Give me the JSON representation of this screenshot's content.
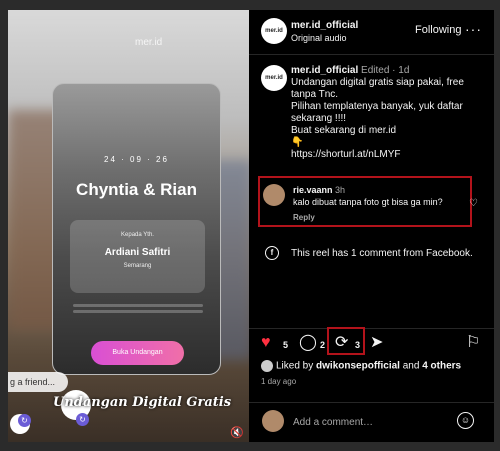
{
  "media": {
    "brand_overlay": "mer.id",
    "invitation_date": "24 · 09 · 26",
    "invitation_names": "Chyntia & Rian",
    "to_label": "Kepada Yth.",
    "guest_name": "Ardiani Safitri",
    "guest_city": "Semarang",
    "open_button": "Buka Undangan",
    "overlay_title": "Undangan Digital Gratis",
    "send_friend": "g a friend...",
    "logo_text": "mer.id",
    "mute_icon": "speaker-muted-icon"
  },
  "header": {
    "username": "mer.id_official",
    "audio": "Original audio",
    "follow_label": "Following",
    "more_label": "···",
    "avatar_text": "mer.id"
  },
  "caption": {
    "username": "mer.id_official",
    "edited": "Edited",
    "age": "1d",
    "lines": [
      "Undangan digital gratis siap pakai, free tanpa Tnc.",
      "Pilihan templatenya banyak, yuk daftar sekarang !!!!",
      "Buat sekarang di mer.id",
      "👇",
      "https://shorturl.at/nLMYF"
    ]
  },
  "comment": {
    "username": "rie.vaann",
    "age": "3h",
    "text": "kalo dibuat tanpa foto gt bisa ga min?",
    "reply": "Reply"
  },
  "facebook_note": "This reel has 1 comment from Facebook.",
  "actions": {
    "likes": "5",
    "comments": "2",
    "reposts": "3"
  },
  "liked_by": {
    "prefix": "Liked by",
    "user": "dwikonsepofficial",
    "middle": "and",
    "others": "4 others"
  },
  "time_ago": "1 day ago",
  "add_comment": {
    "placeholder": "Add a comment…"
  },
  "colors": {
    "highlight_box": "#b3131b",
    "heart": "#ff3040",
    "panel_bg": "#000000"
  }
}
